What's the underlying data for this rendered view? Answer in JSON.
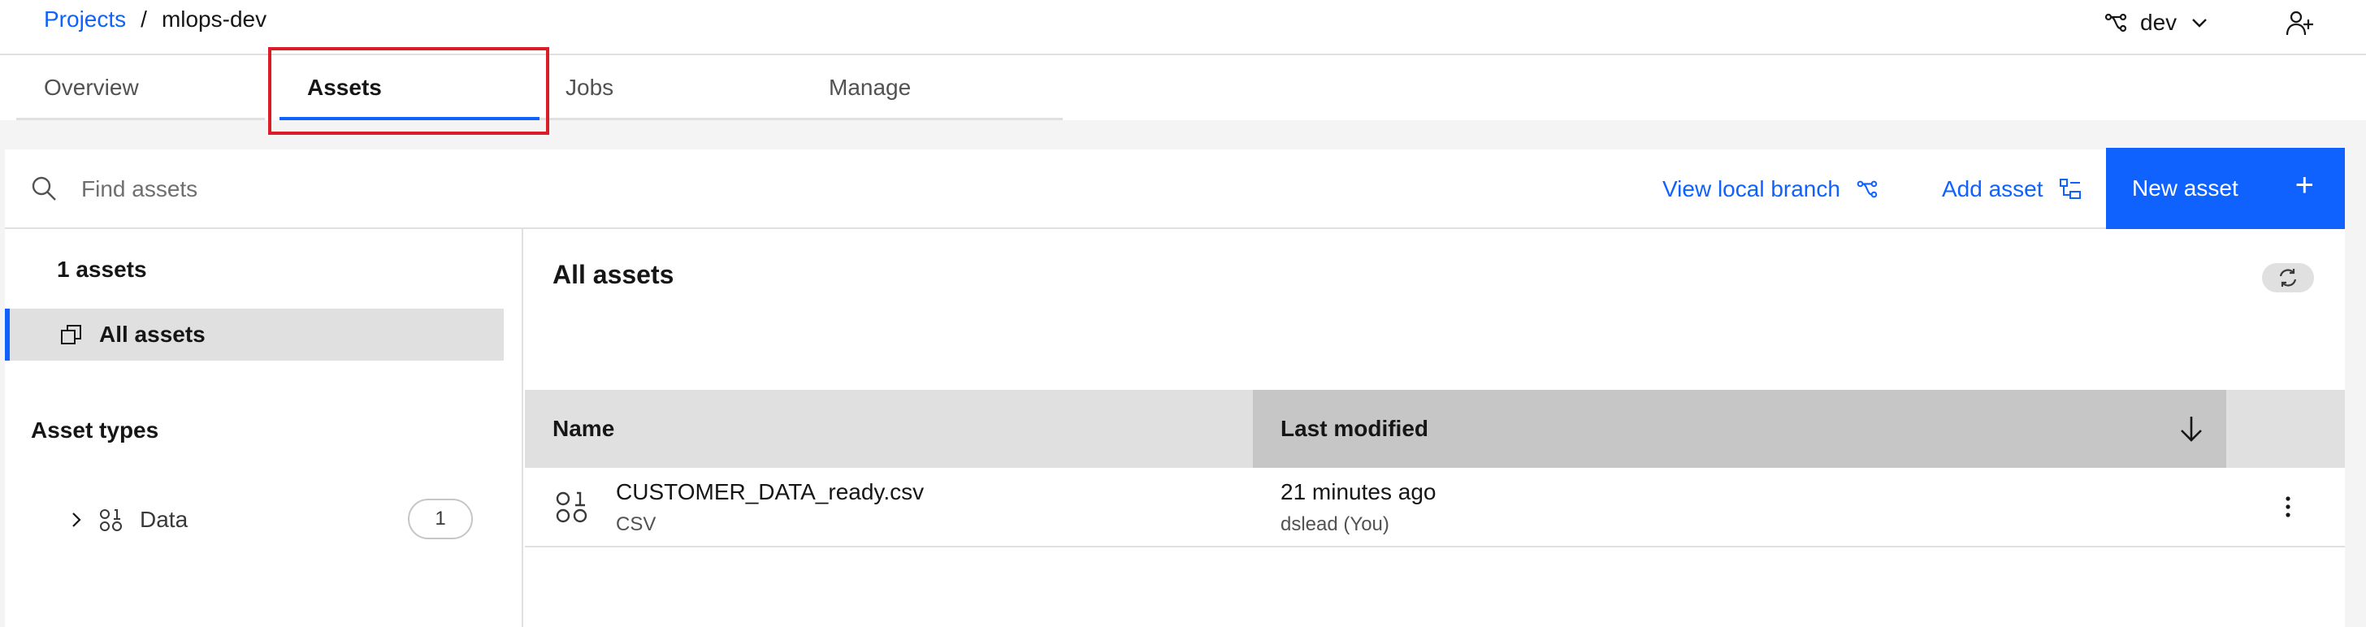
{
  "breadcrumb": {
    "root": "Projects",
    "separator": "/",
    "current": "mlops-dev"
  },
  "branch": {
    "name": "dev"
  },
  "tabs": [
    {
      "label": "Overview"
    },
    {
      "label": "Assets"
    },
    {
      "label": "Jobs"
    },
    {
      "label": "Manage"
    }
  ],
  "active_tab": "Assets",
  "search": {
    "placeholder": "Find assets",
    "value": ""
  },
  "toolbar": {
    "view_branch": "View local branch",
    "add_asset": "Add asset",
    "new_asset": "New asset",
    "plus": "+"
  },
  "sidebar": {
    "count": "1 assets",
    "all_assets": "All assets",
    "types_title": "Asset types",
    "types": [
      {
        "label": "Data",
        "count": "1"
      }
    ]
  },
  "main": {
    "title": "All assets",
    "columns": {
      "name": "Name",
      "modified": "Last modified"
    },
    "rows": [
      {
        "name": "CUSTOMER_DATA_ready.csv",
        "type": "CSV",
        "modified": "21 minutes ago",
        "modified_by": "dslead (You)"
      }
    ]
  },
  "colors": {
    "accent": "#0f62fe",
    "highlight": "#da1e28"
  }
}
